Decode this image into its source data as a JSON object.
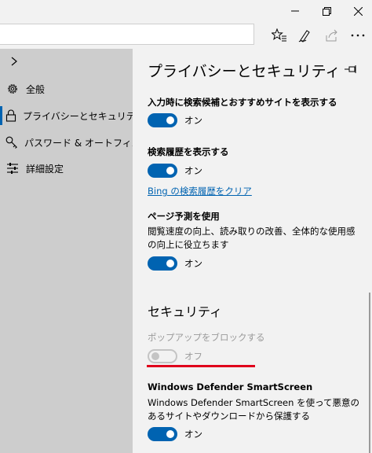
{
  "nav": {
    "items": [
      {
        "label": "全般",
        "icon": "gear-icon"
      },
      {
        "label": "プライバシーとセキュリティ",
        "icon": "lock-icon",
        "active": true
      },
      {
        "label": "パスワード & オートフィル",
        "icon": "key-icon"
      },
      {
        "label": "詳細設定",
        "icon": "sliders-icon"
      }
    ]
  },
  "pane": {
    "title": "プライバシーとセキュリティ",
    "settings": {
      "search_suggestions": {
        "label": "入力時に検索候補とおすすめサイトを表示する",
        "state": "オン"
      },
      "search_history": {
        "label": "検索履歴を表示する",
        "state": "オン",
        "link": "Bing の検索履歴をクリア"
      },
      "page_prediction": {
        "label": "ページ予測を使用",
        "description": "閲覧速度の向上、読み取りの改善、全体的な使用感の向上に役立ちます",
        "state": "オン"
      }
    },
    "security": {
      "title": "セキュリティ",
      "popup_block": {
        "label": "ポップアップをブロックする",
        "state": "オフ"
      },
      "smartscreen": {
        "label": "Windows Defender SmartScreen",
        "description": "Windows Defender SmartScreen を使って悪意のあるサイトやダウンロードから保護する",
        "state": "オン"
      }
    }
  },
  "colors": {
    "accent": "#0063b1",
    "annotation": "#e0001b"
  }
}
